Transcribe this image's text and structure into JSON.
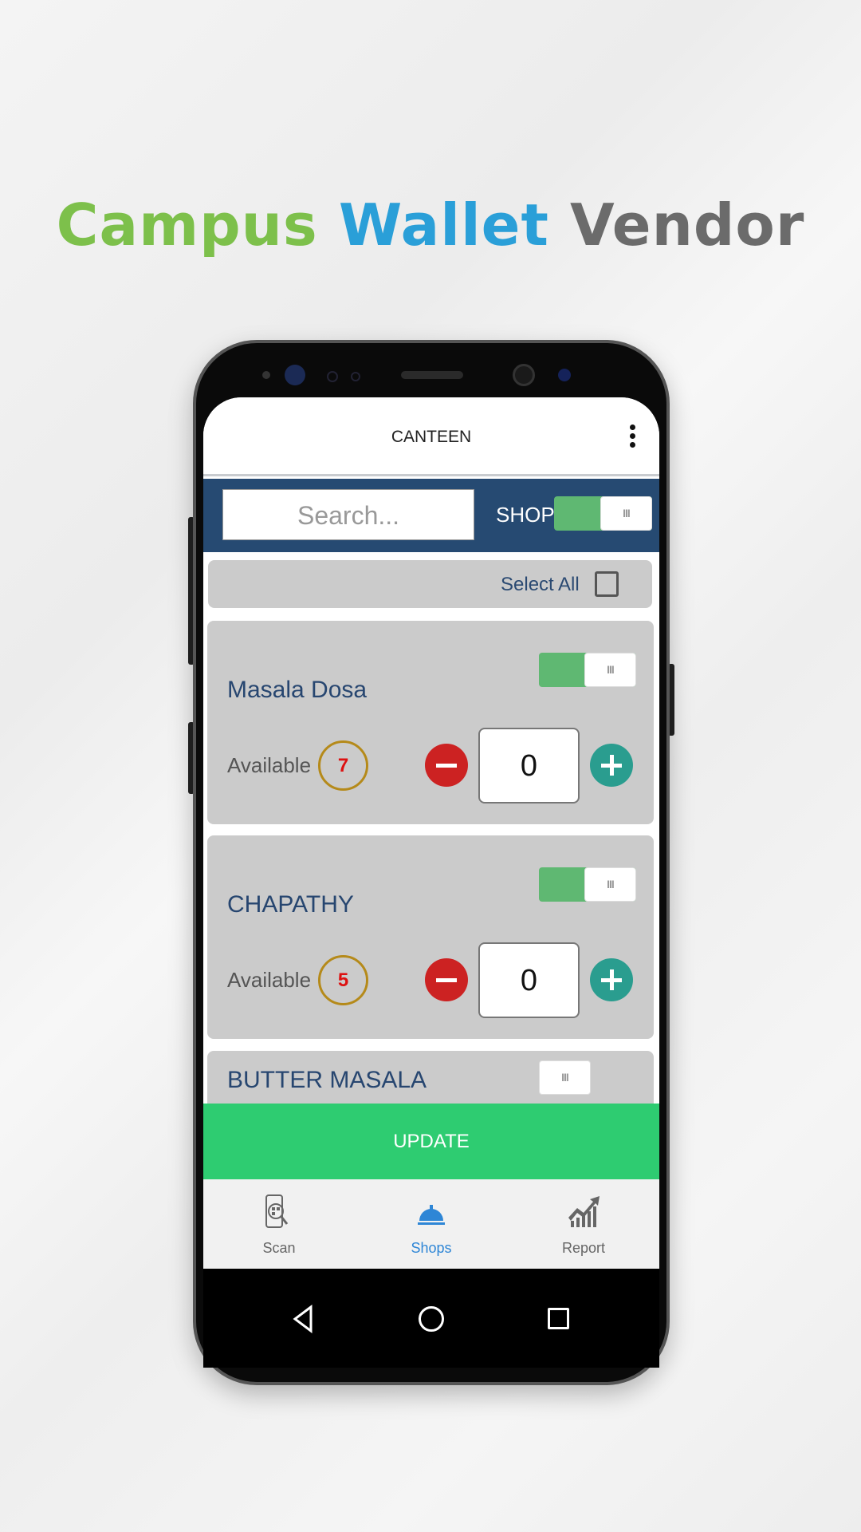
{
  "promo_title": {
    "part1": "Campus",
    "part2": "Wallet",
    "part3": "Vendor",
    "colors": {
      "part1": "#7dc04b",
      "part2": "#2a9fd8",
      "part3": "#6b6b6b"
    }
  },
  "header": {
    "title": "CANTEEN",
    "menu_icon": "more-vertical-icon"
  },
  "toolbar": {
    "search_placeholder": "Search...",
    "shop_label": "SHOP",
    "shop_toggle_on": true
  },
  "select_all": {
    "label": "Select All",
    "checked": false
  },
  "items": [
    {
      "name": "Masala Dosa",
      "enabled": true,
      "available_label": "Available",
      "available": "7",
      "quantity": "0"
    },
    {
      "name": "CHAPATHY",
      "enabled": true,
      "available_label": "Available",
      "available": "5",
      "quantity": "0"
    },
    {
      "name": "BUTTER MASALA",
      "enabled": false
    }
  ],
  "update_label": "UPDATE",
  "bottom_nav": [
    {
      "label": "Scan",
      "icon": "qr-scan-icon",
      "active": false
    },
    {
      "label": "Shops",
      "icon": "service-bell-icon",
      "active": true
    },
    {
      "label": "Report",
      "icon": "chart-growth-icon",
      "active": false
    }
  ],
  "colors": {
    "accent": "#2ecc71",
    "toolbar": "#264a72",
    "active_nav": "#2e86d6"
  }
}
